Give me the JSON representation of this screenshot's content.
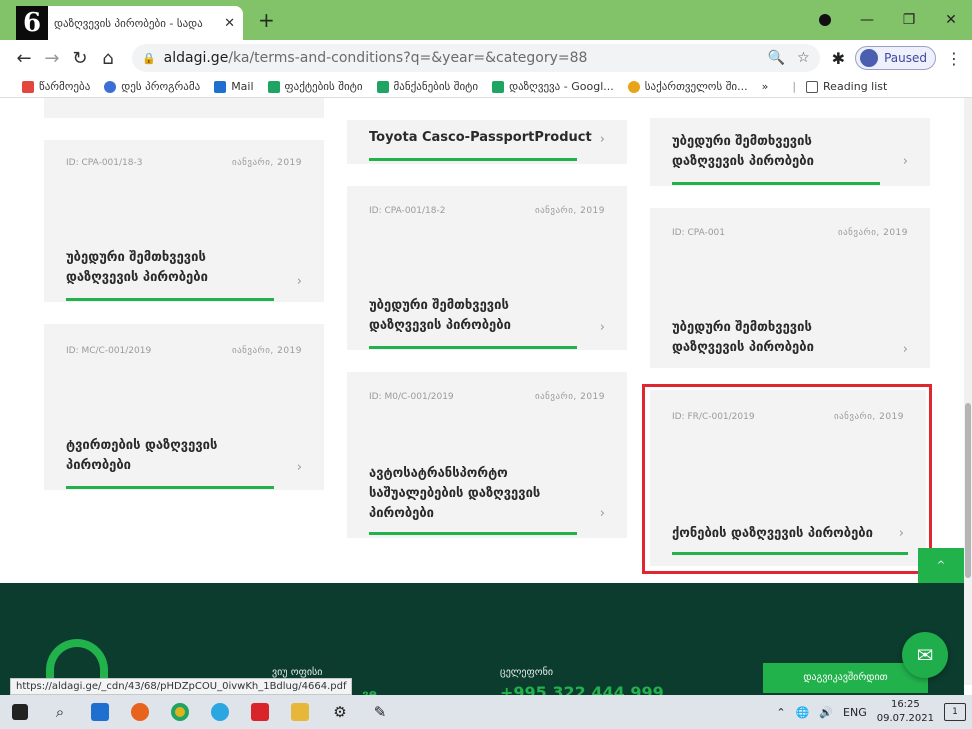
{
  "step_badge": "6",
  "browser": {
    "tab_title": "დაზღვევის პირობები - სადა",
    "tab_close": "✕",
    "new_tab": "+",
    "window_controls": {
      "minimize": "—",
      "maximize": "❐",
      "close": "✕"
    },
    "url": {
      "domain": "aldagi.ge",
      "path": "/ka/terms-and-conditions?q=&year=&category=88"
    },
    "profile_status": "Paused",
    "bookmarks": [
      {
        "label": "წარმოება",
        "icon": "bookmark-icon",
        "color": "#e2463c"
      },
      {
        "label": "დეს პროგრამა",
        "icon": "globe-icon",
        "color": "#3b6fd6"
      },
      {
        "label": "Mail",
        "icon": "outlook-icon",
        "color": "#1f6fd1"
      },
      {
        "label": "ფაქტების შიტი",
        "icon": "sheets-icon",
        "color": "#1fa463"
      },
      {
        "label": "მანქანების შიტი",
        "icon": "sheets-icon",
        "color": "#1fa463"
      },
      {
        "label": "დაზღვევა - Googl...",
        "icon": "sheets-icon",
        "color": "#1fa463"
      },
      {
        "label": "საქართველოს ში...",
        "icon": "location-icon",
        "color": "#e8a317"
      }
    ],
    "bookmarks_overflow": "»",
    "reading_list": "Reading list"
  },
  "cards": [
    {
      "id": "",
      "date": "",
      "title": "",
      "arrow": ""
    },
    {
      "id": "ID: CPA-001/18-3",
      "date": "იანვარი, 2019",
      "title": "უბედური შემთხვევის დაზღვევის პირობები",
      "arrow": "›"
    },
    {
      "id": "ID: MC/C-001/2019",
      "date": "იანვარი, 2019",
      "title": "ტვირთების დაზღვევის პირობები",
      "arrow": "›"
    },
    {
      "id": "",
      "date": "",
      "title": "Toyota Casco-PassportProduct",
      "arrow": "›"
    },
    {
      "id": "ID: CPA-001/18-2",
      "date": "იანვარი, 2019",
      "title": "უბედური შემთხვევის დაზღვევის პირობები",
      "arrow": "›"
    },
    {
      "id": "ID: M0/C-001/2019",
      "date": "იანვარი, 2019",
      "title": "ავტოსატრანსპორტო საშუალებების დაზღვევის პირობები",
      "arrow": "›"
    },
    {
      "id": "",
      "date": "",
      "title": "უბედური შემთხვევის დაზღვევის პირობები",
      "arrow": "›"
    },
    {
      "id": "ID: CPA-001",
      "date": "იანვარი, 2019",
      "title": "უბედური შემთხვევის დაზღვევის პირობები",
      "arrow": "›"
    },
    {
      "id": "ID: FR/C-001/2019",
      "date": "იანვარი, 2019",
      "title": "ქონების დაზღვევის პირობები",
      "arrow": "›"
    }
  ],
  "scroll_top_label": "^",
  "footer": {
    "address_label": "ვიუ ოფისი",
    "phone_label": "ცელეფონი",
    "phone": "+995 322 444 999",
    "contact_button": "დაგვიკავშირდით",
    "stub_text": "ვe"
  },
  "status_url": "https://aldagi.ge/_cdn/43/68/pHDZpCOU_0ivwKh_1Bdlug/4664.pdf",
  "taskbar": {
    "language": "ENG",
    "time": "16:25",
    "date": "09.07.2021",
    "notifications": "1"
  }
}
